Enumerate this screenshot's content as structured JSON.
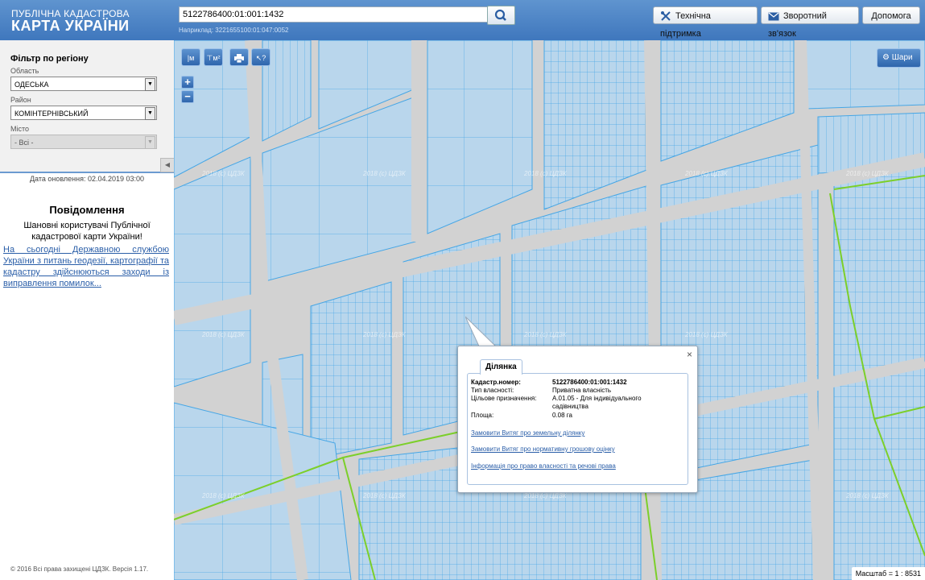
{
  "header": {
    "brand_line1": "ПУБЛІЧНА КАДАСТРОВА",
    "brand_line2": "КАРТА УКРАЇНИ",
    "search_value": "5122786400:01:001:1432",
    "search_example": "Наприклад: 3221655100:01:047:0052",
    "support_label": "Технічна підтримка",
    "feedback_label": "Зворотний зв'язок",
    "help_label": "Допомога"
  },
  "sidebar": {
    "filter_title": "Фільтр по регіону",
    "oblast_label": "Область",
    "oblast_value": "ОДЕСЬКА",
    "raion_label": "Район",
    "raion_value": "КОМІНТЕРНІВСЬКИЙ",
    "misto_label": "Місто",
    "misto_value": "- Всі -",
    "update_date": "Дата оновлення: 02.04.2019 03:00",
    "message_title": "Повідомлення",
    "message_greeting": "Шановні користувачі Публічної кадастрової карти України!",
    "message_link": "На сьогодні Державною службою України з питань геодезії, картографії та кадастру здійснюються заходи із виправлення помилок...",
    "copyright": "© 2016 Всі права захищені ЦДЗК. Версія 1.17."
  },
  "map": {
    "tool_length_label": "м",
    "tool_area_label": "м²",
    "zoom_in": "+",
    "zoom_out": "−",
    "layers_label": "Шари",
    "scale_text": "Масштаб = 1 : 8531",
    "watermark": "2018 (с) ЦДЗК"
  },
  "popup": {
    "tab_label": "Ділянка",
    "close": "×",
    "rows": [
      {
        "key": "Кадастр.номер:",
        "value": "5122786400:01:001:1432"
      },
      {
        "key": "Тип власності:",
        "value": "Приватна власність"
      },
      {
        "key": "Цільове призначення:",
        "value": "A.01.05 - Для індивідуального садівництва"
      },
      {
        "key": "Площа:",
        "value": "0.08 га"
      }
    ],
    "links": [
      "Замовити Витяг про земельну ділянку",
      "Замовити Витяг про нормативну грошову оцінку",
      "Інформація про право власності та речові права"
    ]
  },
  "colors": {
    "header_blue": "#4a82c5",
    "parcel_fill": "#b7d5ec",
    "parcel_line": "#3f9fe0",
    "road": "#d4d4d4",
    "boundary_green": "#7ccf2a"
  }
}
